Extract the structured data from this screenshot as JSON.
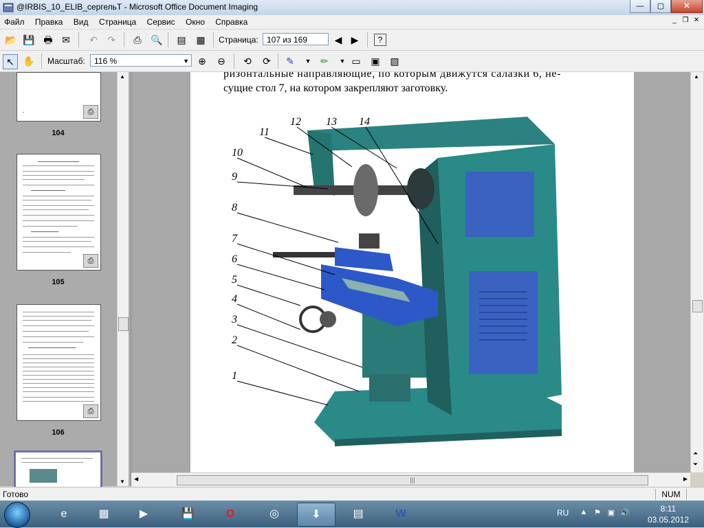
{
  "window": {
    "title": "@IRBIS_10_ELIB_сергельТ - Microsoft Office Document Imaging"
  },
  "menu": [
    "Файл",
    "Правка",
    "Вид",
    "Страница",
    "Сервис",
    "Окно",
    "Справка"
  ],
  "toolbar1": {
    "page_label": "Страница:",
    "page_value": "107 из 169"
  },
  "toolbar2": {
    "zoom_label": "Масштаб:",
    "zoom_value": "116 %"
  },
  "thumbnails": [
    {
      "page": "104"
    },
    {
      "page": "105"
    },
    {
      "page": "106"
    }
  ],
  "document": {
    "line1": "ризонтальные направляющие, по которым движутся салазки 6, не-",
    "line2": "сущие стол 7, на котором закрепляют заготовку.",
    "callouts": [
      "1",
      "2",
      "3",
      "4",
      "5",
      "6",
      "7",
      "8",
      "9",
      "10",
      "11",
      "12",
      "13",
      "14"
    ]
  },
  "status": {
    "text": "Готово",
    "num": "NUM"
  },
  "taskbar": {
    "lang": "RU",
    "time": "8:11",
    "date": "03.05.2012"
  },
  "colors": {
    "machine": "#2a8a88",
    "machine_dark": "#1f5f5e",
    "table_blue": "#2d58c8",
    "panel_blue": "#3a62c0"
  }
}
